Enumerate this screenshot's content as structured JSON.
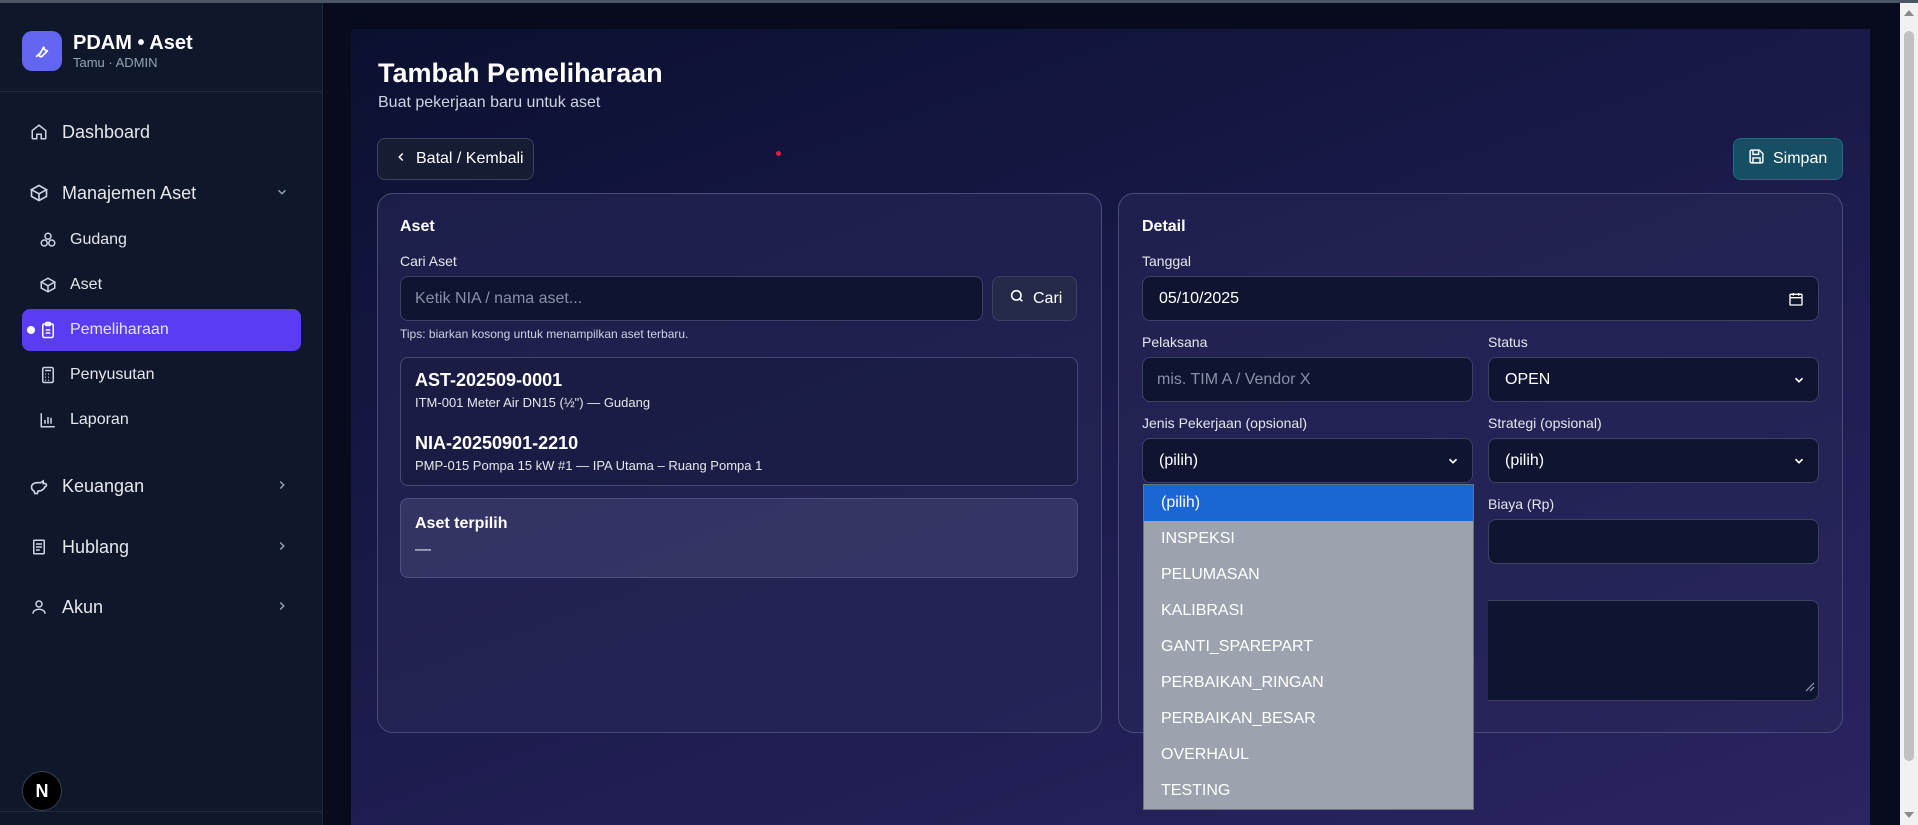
{
  "brand": {
    "title": "PDAM • Aset",
    "subtitle": "Tamu · ADMIN",
    "logo_icon": "wrench-icon"
  },
  "sidebar": {
    "dashboard": {
      "label": "Dashboard",
      "icon": "home-icon"
    },
    "manajemen_aset": {
      "label": "Manajemen Aset",
      "icon": "box-icon",
      "expanded": true,
      "items": [
        {
          "label": "Gudang",
          "icon": "boxes-icon"
        },
        {
          "label": "Aset",
          "icon": "box-icon"
        },
        {
          "label": "Pemeliharaan",
          "icon": "clipboard-icon",
          "active": true
        },
        {
          "label": "Penyusutan",
          "icon": "calculator-icon"
        },
        {
          "label": "Laporan",
          "icon": "bar-chart-icon"
        }
      ]
    },
    "keuangan": {
      "label": "Keuangan",
      "icon": "piggy-bank-icon"
    },
    "hublang": {
      "label": "Hublang",
      "icon": "document-icon"
    },
    "akun": {
      "label": "Akun",
      "icon": "user-icon"
    },
    "badge": "N"
  },
  "page": {
    "title": "Tambah Pemeliharaan",
    "subtitle": "Buat pekerjaan baru untuk aset"
  },
  "actions": {
    "back_label": "Batal / Kembali",
    "save_label": "Simpan"
  },
  "aset_card": {
    "title": "Aset",
    "search_label": "Cari Aset",
    "search_placeholder": "Ketik NIA / nama aset...",
    "search_button": "Cari",
    "tips": "Tips: biarkan kosong untuk menampilkan aset terbaru.",
    "results": [
      {
        "code": "AST-202509-0001",
        "desc": "ITM-001 Meter Air DN15 (½\") — Gudang"
      },
      {
        "code": "NIA-20250901-2210",
        "desc": "PMP-015 Pompa 15 kW #1 — IPA Utama – Ruang Pompa 1"
      }
    ],
    "selected_title": "Aset terpilih",
    "selected_value": "—"
  },
  "detail_card": {
    "title": "Detail",
    "tanggal_label": "Tanggal",
    "tanggal_value": "05/10/2025",
    "pelaksana_label": "Pelaksana",
    "pelaksana_placeholder": "mis. TIM A / Vendor X",
    "status_label": "Status",
    "status_value": "OPEN",
    "jenis_label": "Jenis Pekerjaan (opsional)",
    "jenis_value": "(pilih)",
    "strategi_label": "Strategi (opsional)",
    "strategi_value": "(pilih)",
    "biaya_label": "Biaya (Rp)"
  },
  "jenis_options": [
    "(pilih)",
    "INSPEKSI",
    "PELUMASAN",
    "KALIBRASI",
    "GANTI_SPAREPART",
    "PERBAIKAN_RINGAN",
    "PERBAIKAN_BESAR",
    "OVERHAUL",
    "TESTING"
  ]
}
